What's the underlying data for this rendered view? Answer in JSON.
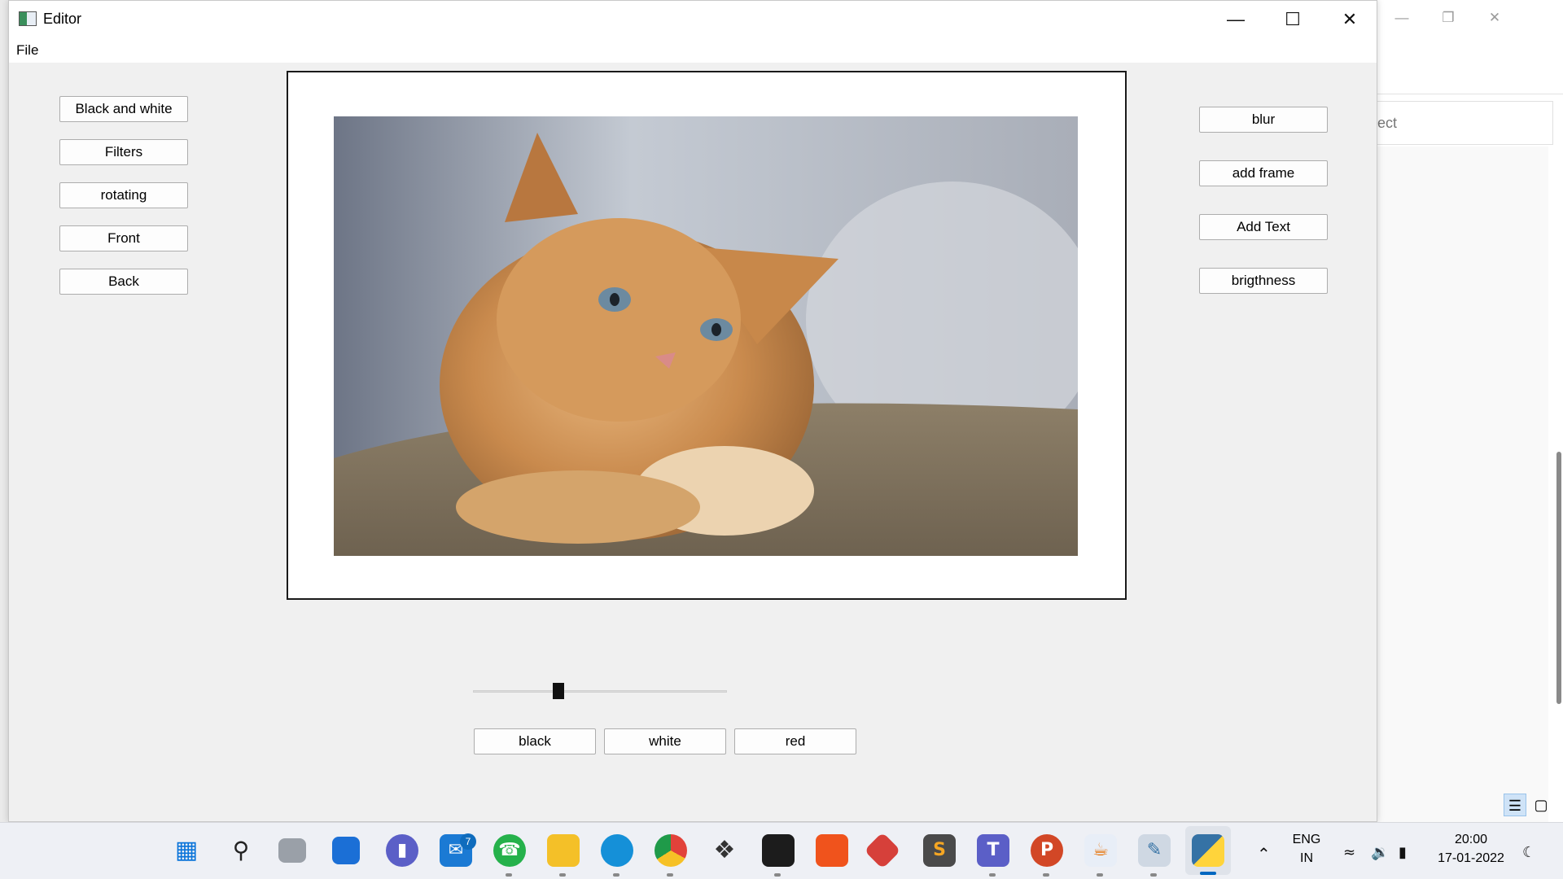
{
  "window": {
    "title": "Editor"
  },
  "menu": {
    "file": "File"
  },
  "left_buttons": [
    "Black and white",
    "Filters",
    "rotating",
    "Front",
    "Back"
  ],
  "right_buttons": [
    "blur",
    "add frame",
    "Add Text",
    "brigthness"
  ],
  "color_buttons": [
    "black",
    "white",
    "red"
  ],
  "slider": {
    "value_fraction": 0.33
  },
  "background_window": {
    "search_partial_text": "ect"
  },
  "taskbar": {
    "mail_badge": "7",
    "language": "ENG",
    "region": "IN",
    "time": "20:00",
    "date": "17-01-2022"
  },
  "colors": {
    "accent": "#0067c0",
    "frame_border": "#1a1a1a",
    "button_bg": "#fdfdfd",
    "button_border": "#adadad",
    "slider_handle": "#111111"
  },
  "icons": {
    "start": "windows-start-icon",
    "search": "search-icon",
    "task_view": "task-view-icon",
    "widgets": "widgets-icon",
    "chat": "chat-icon",
    "mail": "mail-icon",
    "whatsapp": "whatsapp-icon",
    "explorer": "file-explorer-icon",
    "edge": "edge-icon",
    "chrome": "chrome-icon",
    "dropbox": "dropbox-icon",
    "terminal": "terminal-icon",
    "brave": "brave-icon",
    "git": "git-icon",
    "sublime": "sublime-text-icon",
    "teams": "teams-icon",
    "powerpoint": "powerpoint-icon",
    "java": "java-icon",
    "python_idle": "python-idle-icon",
    "python": "python-icon"
  }
}
